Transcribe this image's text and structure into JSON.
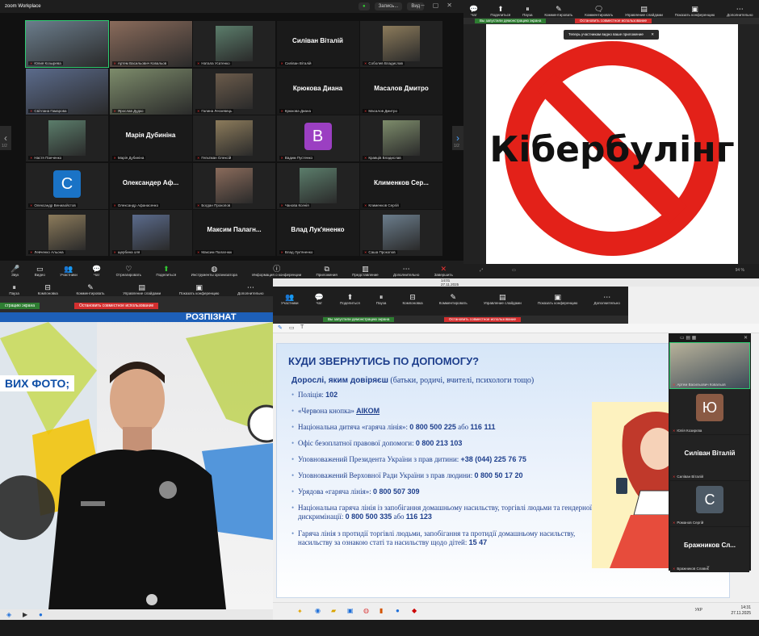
{
  "gallery": {
    "app_logo": "zoom Workplace",
    "recording_label": "Запись...",
    "view_label": "Вид",
    "page_left": "1/2",
    "page_right": "1/2",
    "participants": [
      {
        "name": "Юлия Козырева",
        "kind": "photo"
      },
      {
        "name": "Артем Васильович Ковальов",
        "kind": "photo"
      },
      {
        "name": "Натала Усатенко",
        "kind": "photo"
      },
      {
        "name": "Силіван Віталій",
        "kind": "name"
      },
      {
        "name": "Соболев Владислав",
        "kind": "photo"
      },
      {
        "name": "Світлана Гамарова",
        "kind": "photo"
      },
      {
        "name": "Ярослав Дудко",
        "kind": "photo"
      },
      {
        "name": "Галина Лескевець",
        "kind": "photo"
      },
      {
        "name": "Крюкова Диана",
        "kind": "name"
      },
      {
        "name": "Масалов Дмитро",
        "kind": "name"
      },
      {
        "name": "Настя Панченко",
        "kind": "photo"
      },
      {
        "name": "Марія Дубиніна",
        "kind": "name"
      },
      {
        "name": "Гельтман Олексій",
        "kind": "photo"
      },
      {
        "name": "Вадим Пустенко",
        "kind": "avatar",
        "letter": "В",
        "color": "#9b3fc2"
      },
      {
        "name": "Кравців Владислав",
        "kind": "photo"
      },
      {
        "name": "Олександр Вениаойстов",
        "kind": "avatar",
        "letter": "С",
        "color": "#1a73c6"
      },
      {
        "name": "Олександр Афанасенко",
        "kind": "name",
        "big": "Олександер Аф..."
      },
      {
        "name": "Богдан Прокопов",
        "kind": "photo"
      },
      {
        "name": "Чанова Ксенія",
        "kind": "photo"
      },
      {
        "name": "Клименков Сергій",
        "kind": "name",
        "big": "Клименков Сер..."
      },
      {
        "name": "Левченко Альона",
        "kind": "photo"
      },
      {
        "name": "щербина оля",
        "kind": "photo"
      },
      {
        "name": "Максим Палагнюк",
        "kind": "name",
        "big": "Максим Палагн..."
      },
      {
        "name": "Влад Лук'яненко",
        "kind": "name"
      },
      {
        "name": "Саша Прокопов",
        "kind": "photo"
      }
    ],
    "toolbar": [
      {
        "icon": "🎤",
        "label": "Звук",
        "name": "mic-icon"
      },
      {
        "icon": "▭",
        "label": "Видео",
        "name": "video-icon"
      },
      {
        "icon": "👥",
        "label": "Участники",
        "name": "participants-icon"
      },
      {
        "icon": "💬",
        "label": "Чат",
        "name": "chat-icon"
      },
      {
        "icon": "♡",
        "label": "Отреагировать",
        "name": "react-icon"
      },
      {
        "icon": "⬆",
        "label": "Поделиться",
        "name": "share-icon",
        "green": true
      },
      {
        "icon": "◍",
        "label": "Инструменты организатора",
        "name": "host-tools-icon"
      },
      {
        "icon": "ⓘ",
        "label": "Информация о конференции",
        "name": "info-icon"
      },
      {
        "icon": "⧉",
        "label": "Приложения",
        "name": "apps-icon"
      },
      {
        "icon": "▥",
        "label": "Представление",
        "name": "view-icon"
      },
      {
        "icon": "⋯",
        "label": "Дополнительно",
        "name": "more-icon"
      },
      {
        "icon": "✕",
        "label": "Завершить",
        "name": "end-icon",
        "red": true
      }
    ]
  },
  "presenter": {
    "toolbar": [
      {
        "icon": "💬",
        "label": "Чат"
      },
      {
        "icon": "⬆",
        "label": "Поделиться"
      },
      {
        "icon": "⏸",
        "label": "Пауза"
      },
      {
        "icon": "✎",
        "label": "Комментировать"
      },
      {
        "icon": "🗨",
        "label": "Комментировать"
      },
      {
        "icon": "▤",
        "label": "Управление слайдами"
      },
      {
        "icon": "▣",
        "label": "Показать конференцию"
      },
      {
        "icon": "⋯",
        "label": "Дополнительно"
      }
    ],
    "share_label": "Вы запустили демонстрацию экрана",
    "stop_label": "Остановить совместное использование",
    "toast": "Теперь участникам видно ваше приложение",
    "slide_word": "Кібербулінг",
    "zoom": "94 %"
  },
  "speaker": {
    "toolbar": [
      {
        "icon": "⏸",
        "label": "Пауза"
      },
      {
        "icon": "⊟",
        "label": "Компоновка"
      },
      {
        "icon": "✎",
        "label": "Комментировать"
      },
      {
        "icon": "▤",
        "label": "Управление слайдами"
      },
      {
        "icon": "▣",
        "label": "Показать конференцию"
      },
      {
        "icon": "⋯",
        "label": "Дополнительно"
      }
    ],
    "share_label": "страцию экрана",
    "stop_label": "Остановить совместное использование",
    "caption": "ВИХ ФОТО;",
    "banner_text": "РОЗПІЗНАТ"
  },
  "help": {
    "toolbar": [
      {
        "icon": "👥",
        "label": "Участники"
      },
      {
        "icon": "💬",
        "label": "Чат"
      },
      {
        "icon": "⬆",
        "label": "Поделиться"
      },
      {
        "icon": "⏸",
        "label": "Пауза"
      },
      {
        "icon": "⊟",
        "label": "Компоновка"
      },
      {
        "icon": "✎",
        "label": "Комментировать"
      },
      {
        "icon": "▤",
        "label": "Управление слайдами"
      },
      {
        "icon": "▣",
        "label": "Показать конференцию"
      },
      {
        "icon": "⋯",
        "label": "Дополнительно"
      }
    ],
    "share_label": "Вы запустили демонстрацию экрана",
    "stop_label": "Остановить совместное использование",
    "top_time": "14:01",
    "top_date": "27.11.2025",
    "title": "КУДИ ЗВЕРНУТИСЬ ПО ДОПОМОГУ?",
    "subtitle_bold": "Дорослі, яким довіряєш",
    "subtitle_rest": " (батьки, родичі, вчителі, психологи тощо)",
    "items": [
      {
        "text": "Поліція: ",
        "bold": "102"
      },
      {
        "text": "«Червона кнопка» ",
        "bold": "АІКОМ"
      },
      {
        "text": "Національна дитяча «гаряча лінія»: ",
        "bold": "0 800 500 225",
        "mid": " або ",
        "bold2": "116 111"
      },
      {
        "text": "Офіс безоплатної правової допомоги: ",
        "bold": "0 800 213 103"
      },
      {
        "text": "Уповноважений Президента України з прав дитини: ",
        "bold": "+38 (044) 225 76 75"
      },
      {
        "text": "Уповноважений Верховної Ради України з прав людини: ",
        "bold": "0 800 50 17 20"
      },
      {
        "text": "Урядова «гаряча лінія»: ",
        "bold": "0 800 507 309"
      },
      {
        "text": "Національна гаряча лінія із запобігання домашньому насильству, торгівлі людьми та гендерної дискримінації: ",
        "bold": "0 800 500 335",
        "mid": " або ",
        "bold2": "116 123"
      },
      {
        "text": "Гаряча лінія з протидії торгівлі людьми, запобігання та протидії домашньому насильству, насильству за ознакою статі та насильству щодо дітей: ",
        "bold": "15 47"
      }
    ],
    "side": [
      {
        "name": "Артем Васильович Ковальов",
        "kind": "photo"
      },
      {
        "name": "Юлія Козирєва",
        "kind": "avatar",
        "letter": "Ю",
        "color": "#8a5a44"
      },
      {
        "name": "Силіван Віталій",
        "kind": "name"
      },
      {
        "name": "Романов Сергій",
        "kind": "avatar",
        "letter": "С",
        "color": "#4d5a66"
      },
      {
        "name": "Бражников Славик",
        "kind": "name",
        "big": "Бражников Сл..."
      }
    ],
    "taskbar_lang": "УКР",
    "taskbar_time": "14:31",
    "taskbar_date": "27.11.2025"
  }
}
